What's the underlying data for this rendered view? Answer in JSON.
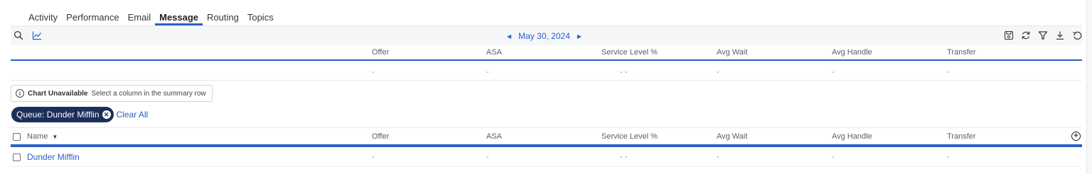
{
  "tabs": [
    {
      "label": "Activity"
    },
    {
      "label": "Performance"
    },
    {
      "label": "Email"
    },
    {
      "label": "Message",
      "active": true
    },
    {
      "label": "Routing"
    },
    {
      "label": "Topics"
    }
  ],
  "toolbar": {
    "left_icons": [
      "search-icon",
      "chart-icon"
    ],
    "date_label": "May 30, 2024",
    "right_icons": [
      "save-icon",
      "refresh-icon",
      "filter-icon",
      "download-icon",
      "reset-icon"
    ]
  },
  "columns": [
    "Offer",
    "ASA",
    "Service Level %",
    "Avg Wait",
    "Avg Handle",
    "Transfer"
  ],
  "summary": {
    "values": [
      "-",
      "-",
      "- -",
      "-",
      "-",
      "-"
    ]
  },
  "chart_note": {
    "title": "Chart Unavailable",
    "message": "Select a column in the summary row"
  },
  "filters": {
    "chip_label": "Queue: Dunder Mifflin",
    "clear_label": "Clear All"
  },
  "grid": {
    "name_header": "Name",
    "sort_glyph": "▼",
    "rows": [
      {
        "name": "Dunder Mifflin",
        "values": [
          "-",
          "-",
          "- -",
          "-",
          "-",
          "-"
        ]
      }
    ]
  },
  "colors": {
    "accent": "#2a60c8",
    "chip": "#1c2e5a"
  }
}
